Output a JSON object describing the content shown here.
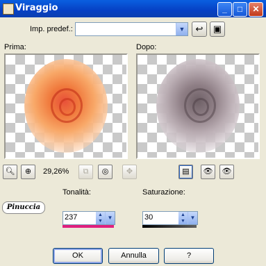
{
  "window": {
    "title": "Viraggio"
  },
  "titlebar_buttons": {
    "minimize": "_",
    "maximize": "□",
    "close": "✕"
  },
  "preset": {
    "label": "Imp. predef.:",
    "value": ""
  },
  "preview": {
    "before_label": "Prima:",
    "after_label": "Dopo:"
  },
  "zoom": {
    "level": "29,26%"
  },
  "hue": {
    "label": "Tonalità:",
    "value": "237",
    "color": "#e0207e"
  },
  "saturation": {
    "label": "Saturazione:",
    "value": "30",
    "color": "#606060"
  },
  "logo_text": "Pinuccia",
  "buttons": {
    "ok": "OK",
    "cancel": "Annulla",
    "help": "?"
  }
}
